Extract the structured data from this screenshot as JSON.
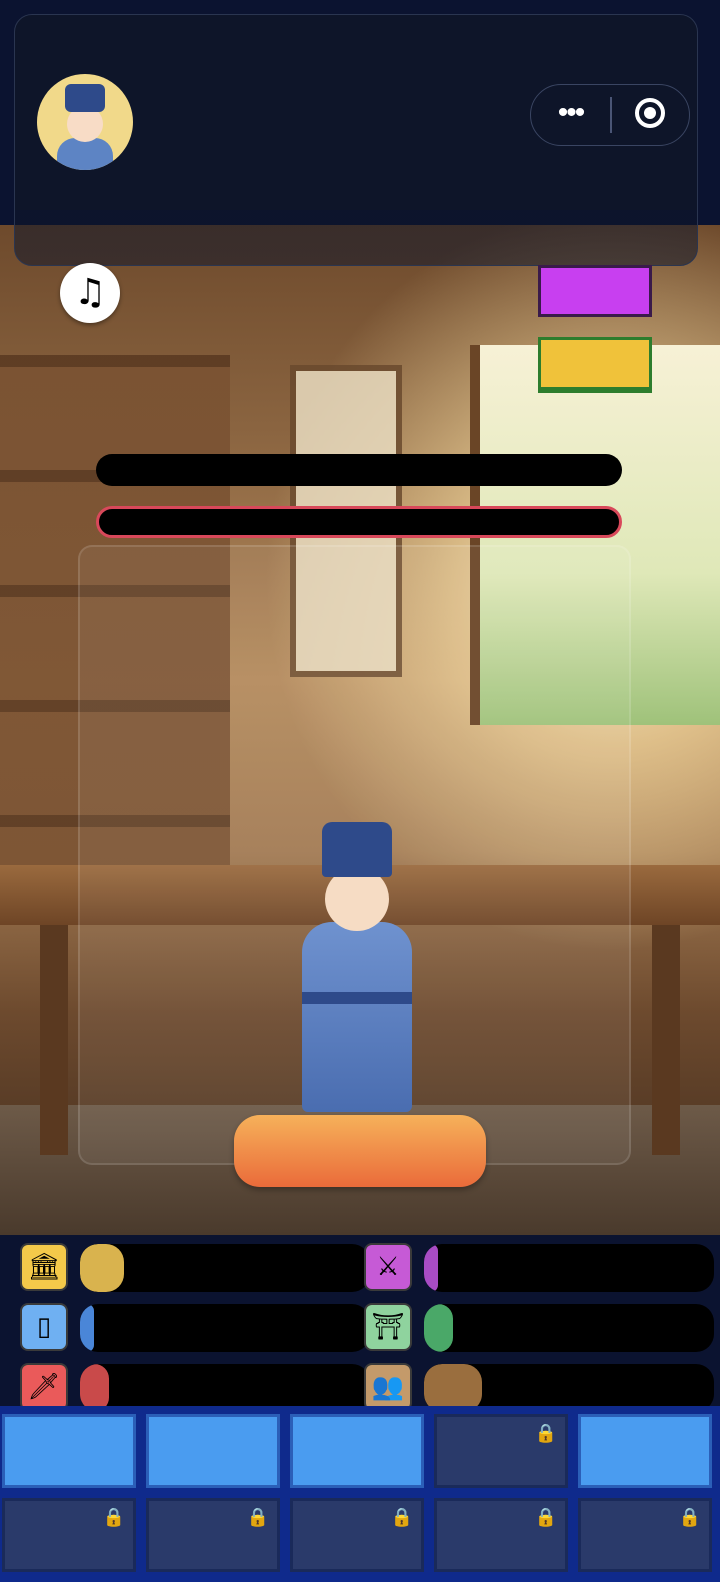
{
  "header": {
    "avatar": "scholar-avatar",
    "menu_icon": "more-dots-icon",
    "target_icon": "record-target-icon"
  },
  "controls": {
    "music_icon": "♫",
    "purple_tag_color": "#c83ff0",
    "yellow_tag_color": "#f0c23a"
  },
  "bars": {
    "bar1_color": "#000000",
    "bar2_border_color": "#d8485a"
  },
  "action_button": {
    "label": "",
    "gradient": [
      "#f6b15a",
      "#ea6b3a"
    ]
  },
  "stats": [
    {
      "icon": "money-building-icon",
      "glyph": "🏛",
      "icon_bg": "#f4c94a",
      "fill_color": "#d9b34e",
      "fill_pct": 15
    },
    {
      "icon": "warrior-icon",
      "glyph": "⚔",
      "icon_bg": "#c65ad6",
      "fill_color": "#a84cc4",
      "fill_pct": 4
    },
    {
      "icon": "jade-icon",
      "glyph": "▯",
      "icon_bg": "#6fb0f2",
      "fill_color": "#4a86d8",
      "fill_pct": 4
    },
    {
      "icon": "tablet-icon",
      "glyph": "⛩",
      "icon_bg": "#8fd39e",
      "fill_color": "#4aa868",
      "fill_pct": 10
    },
    {
      "icon": "sword-icon",
      "glyph": "🗡",
      "icon_bg": "#ea5a5a",
      "fill_color": "#c94a4a",
      "fill_pct": 10
    },
    {
      "icon": "people-icon",
      "glyph": "👥",
      "icon_bg": "#c49a6a",
      "fill_color": "#9a6e3e",
      "fill_pct": 20
    }
  ],
  "slots": [
    {
      "state": "open"
    },
    {
      "state": "open"
    },
    {
      "state": "open"
    },
    {
      "state": "locked"
    },
    {
      "state": "open"
    },
    {
      "state": "locked"
    },
    {
      "state": "locked"
    },
    {
      "state": "locked"
    },
    {
      "state": "locked"
    },
    {
      "state": "locked"
    }
  ],
  "lock_glyph": "🔒"
}
